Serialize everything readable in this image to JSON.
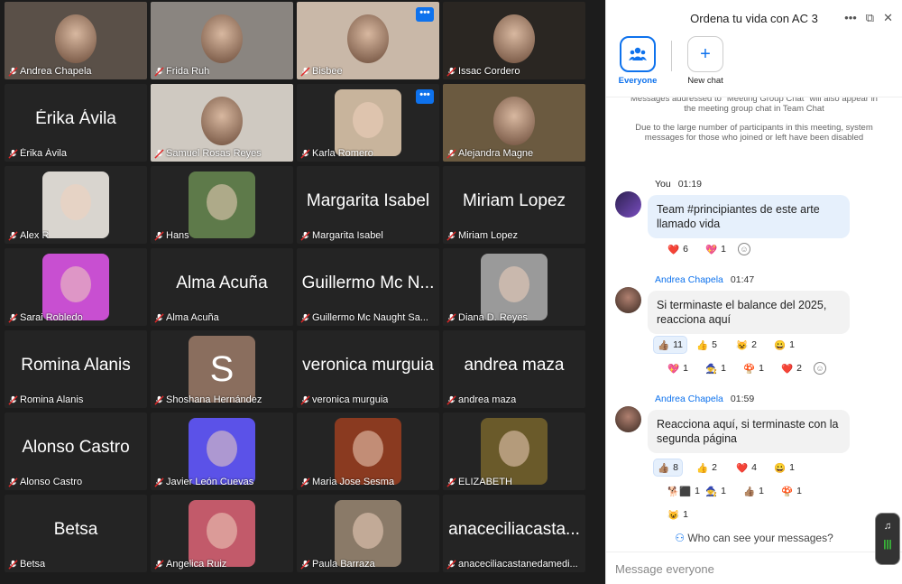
{
  "gallery": {
    "tiles": [
      {
        "name": "Andrea Chapela",
        "type": "video",
        "bg": "#5a5048"
      },
      {
        "name": "Frida Ruh",
        "type": "video",
        "bg": "#8a8580"
      },
      {
        "name": "Bisbee",
        "type": "video",
        "bg": "#c9b8a8",
        "menu": "•••"
      },
      {
        "name": "Issac Cordero",
        "type": "video",
        "bg": "#2a2622"
      },
      {
        "name": "Érika Ávila",
        "type": "name",
        "big": "Érika Ávila"
      },
      {
        "name": "Samuel Rosas Reyes",
        "type": "video",
        "bg": "#cfc9c1"
      },
      {
        "name": "Karla Romero",
        "type": "photo",
        "bg": "#c8b49c",
        "menu": "•••"
      },
      {
        "name": "Alejandra Magne",
        "type": "video",
        "bg": "#6b5a40"
      },
      {
        "name": "Alex R",
        "type": "photo",
        "bg": "#d9d5cf"
      },
      {
        "name": "Hans",
        "type": "photo",
        "bg": "#5e7a4a"
      },
      {
        "name": "Margarita Isabel",
        "type": "name",
        "big": "Margarita Isabel"
      },
      {
        "name": "Miriam Lopez",
        "type": "name",
        "big": "Miriam Lopez"
      },
      {
        "name": "Sarai Robledo",
        "type": "photo",
        "bg": "#c84fd1"
      },
      {
        "name": "Alma Acuña",
        "type": "name",
        "big": "Alma Acuña"
      },
      {
        "name": "Guillermo Mc Naught Sa...",
        "type": "name",
        "big": "Guillermo Mc N..."
      },
      {
        "name": "Diana D. Reyes",
        "type": "photo",
        "bg": "#9a9a9a"
      },
      {
        "name": "Romina Alanis",
        "type": "name",
        "big": "Romina Alanis"
      },
      {
        "name": "Shoshana Hernández",
        "type": "letter",
        "bg": "#8a6e5e",
        "letter": "S"
      },
      {
        "name": "veronica murguia",
        "type": "name",
        "big": "veronica murguia"
      },
      {
        "name": "andrea maza",
        "type": "name",
        "big": "andrea maza"
      },
      {
        "name": "Alonso Castro",
        "type": "name",
        "big": "Alonso Castro"
      },
      {
        "name": "Javier León Cuevas",
        "type": "photo",
        "bg": "#5b52e8"
      },
      {
        "name": "Maria Jose Sesma",
        "type": "photo",
        "bg": "#8a3a20"
      },
      {
        "name": "ELIZABETH",
        "type": "photo",
        "bg": "#6a5a2a"
      },
      {
        "name": "Betsa",
        "type": "name",
        "big": "Betsa"
      },
      {
        "name": "Angelica Ruiz",
        "type": "photo",
        "bg": "#c25a6a"
      },
      {
        "name": "Paula Barraza",
        "type": "photo",
        "bg": "#8a7a68"
      },
      {
        "name": "anaceciliacastanedamedi...",
        "type": "name",
        "big": "anaceciliacasta..."
      }
    ]
  },
  "panel": {
    "title": "Ordena tu vida con AC 3",
    "tabs": [
      {
        "label": "Everyone",
        "icon": "people-icon"
      },
      {
        "label": "New chat",
        "icon": "plus-icon"
      }
    ],
    "system_note_1": "Messages addressed to \"Meeting Group Chat\" will also appear in the meeting group chat in Team Chat",
    "system_note_2": "Due to the large number of participants in this meeting, system messages for those who joined or left have been disabled",
    "messages": [
      {
        "author": "You",
        "time": "01:19",
        "text": "Team #principiantes de este arte llamado vida",
        "reactions": [
          {
            "emoji": "❤️",
            "count": "6"
          },
          {
            "emoji": "💖",
            "count": "1"
          }
        ]
      },
      {
        "author": "Andrea Chapela",
        "time": "01:47",
        "text": "Si terminaste el balance del 2025, reacciona aquí",
        "reactions": [
          {
            "emoji": "👍🏽",
            "count": "11"
          },
          {
            "emoji": "👍",
            "count": "5"
          },
          {
            "emoji": "😺",
            "count": "2"
          },
          {
            "emoji": "😀",
            "count": "1"
          },
          {
            "emoji": "💖",
            "count": "1"
          },
          {
            "emoji": "🧙",
            "count": "1"
          },
          {
            "emoji": "🍄",
            "count": "1"
          },
          {
            "emoji": "❤️",
            "count": "2"
          }
        ]
      },
      {
        "author": "Andrea Chapela",
        "time": "01:59",
        "text": "Reacciona aquí, si terminaste con la segunda página",
        "reactions": [
          {
            "emoji": "👍🏽",
            "count": "8"
          },
          {
            "emoji": "👍",
            "count": "2"
          },
          {
            "emoji": "❤️",
            "count": "4"
          },
          {
            "emoji": "😀",
            "count": "1"
          },
          {
            "emoji": "🐕‍⬛",
            "count": "1"
          },
          {
            "emoji": "🧙",
            "count": "1"
          },
          {
            "emoji": "👍🏽",
            "count": "1"
          },
          {
            "emoji": "🍄",
            "count": "1"
          },
          {
            "emoji": "😺",
            "count": "1"
          }
        ]
      }
    ],
    "who_can_see": "Who can see your messages?",
    "input_placeholder": "Message everyone"
  }
}
